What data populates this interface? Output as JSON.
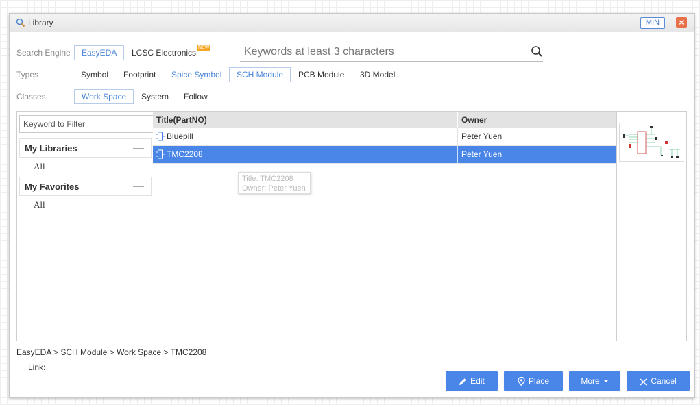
{
  "window": {
    "title": "Library",
    "min_label": "MIN",
    "close_label": "×"
  },
  "search_engine": {
    "label": "Search Engine",
    "options": [
      "EasyEDA",
      "LCSC Electronics"
    ],
    "selected": "EasyEDA",
    "new_badge": "NEW"
  },
  "search": {
    "placeholder": "Keywords at least 3 characters",
    "value": ""
  },
  "types": {
    "label": "Types",
    "options": [
      "Symbol",
      "Footprint",
      "Spice Symbol",
      "SCH Module",
      "PCB Module",
      "3D Model"
    ],
    "selected": "SCH Module"
  },
  "classes": {
    "label": "Classes",
    "options": [
      "Work Space",
      "System",
      "Follow"
    ],
    "selected": "Work Space"
  },
  "left_panel": {
    "filter_placeholder": "Keyword to Filter",
    "sections": [
      {
        "title": "My Libraries",
        "items": [
          "All"
        ]
      },
      {
        "title": "My Favorites",
        "items": [
          "All"
        ]
      }
    ]
  },
  "table": {
    "columns": [
      "Title(PartNO)",
      "Owner"
    ],
    "rows": [
      {
        "title": "Bluepill",
        "owner": "Peter Yuen",
        "selected": false
      },
      {
        "title": "TMC2208",
        "owner": "Peter Yuen",
        "selected": true
      }
    ]
  },
  "tooltip": {
    "title_line": "Title: TMC2208",
    "owner_line": "Owner: Peter Yuen"
  },
  "footer": {
    "breadcrumb": "EasyEDA > SCH Module > Work Space > TMC2208",
    "link_label": "Link:",
    "buttons": {
      "edit": "Edit",
      "place": "Place",
      "more": "More",
      "cancel": "Cancel"
    }
  },
  "colors": {
    "accent": "#4a86e8",
    "close": "#e8714a",
    "badge": "#f5a623"
  }
}
